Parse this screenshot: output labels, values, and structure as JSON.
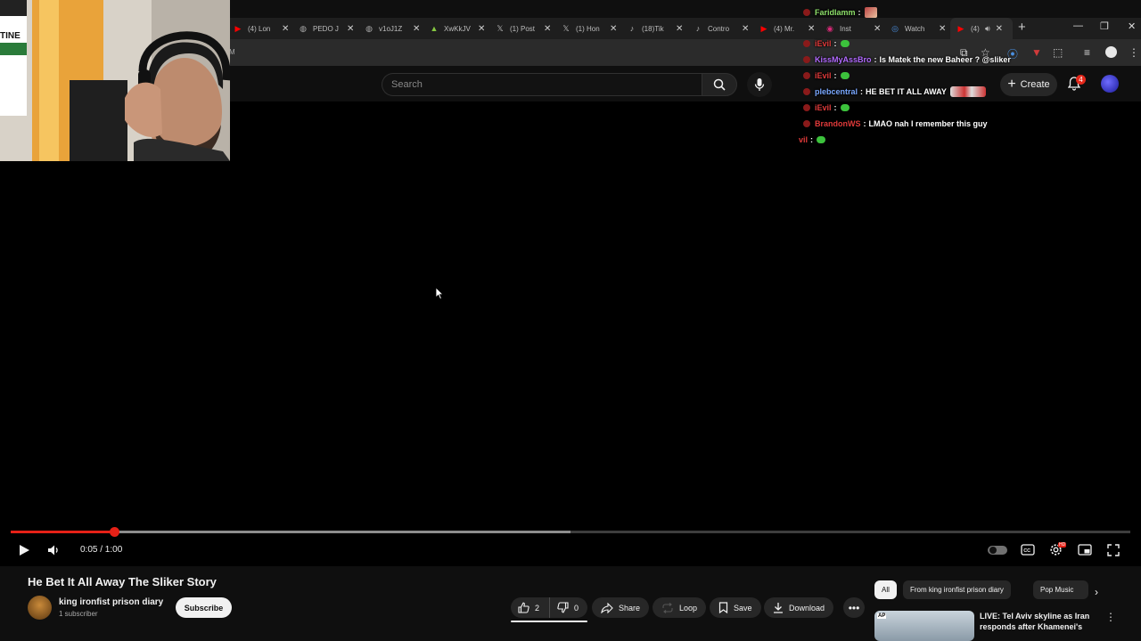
{
  "browser": {
    "tabs": [
      {
        "title": "(4) Lon",
        "icon": "youtube-icon",
        "color": "#ff0000"
      },
      {
        "title": "PEDO J",
        "icon": "globe-icon",
        "color": "#aaaaaa"
      },
      {
        "title": "v1oJ1Z",
        "icon": "globe-icon",
        "color": "#aaaaaa"
      },
      {
        "title": "XwKkJV",
        "icon": "rumble-icon",
        "color": "#85c742"
      },
      {
        "title": "(1) Post",
        "icon": "x-icon",
        "color": "#ffffff"
      },
      {
        "title": "(1) Hon",
        "icon": "x-icon",
        "color": "#ffffff"
      },
      {
        "title": "(18)Tik",
        "icon": "tiktok-icon",
        "color": "#ffffff"
      },
      {
        "title": "Contro",
        "icon": "tiktok-icon",
        "color": "#ffffff"
      },
      {
        "title": "(4) Mr.",
        "icon": "youtube-icon",
        "color": "#ff0000"
      },
      {
        "title": "Inst",
        "icon": "instagram-icon",
        "color": "#d62976"
      },
      {
        "title": "Watch",
        "icon": "watch-icon",
        "color": "#4a90e2"
      },
      {
        "title": "(4)",
        "icon": "youtube-icon",
        "color": "#ff0000"
      }
    ],
    "address_fragment": "M"
  },
  "header": {
    "search_placeholder": "Search",
    "create_label": "Create",
    "notification_count": "4"
  },
  "player": {
    "time": "0:05 / 1:00",
    "progress_fraction": 0.0925,
    "buffered_fraction": 0.5
  },
  "video": {
    "title": "He Bet It All Away The Sliker Story",
    "channel": "king ironfist prison diary",
    "subscribers": "1 subscriber",
    "subscribe_label": "Subscribe",
    "likes": "2",
    "dislikes": "0",
    "share_label": "Share",
    "loop_label": "Loop",
    "save_label": "Save",
    "download_label": "Download"
  },
  "chips": [
    "All",
    "From king ironfist prison diary",
    "Pop Music"
  ],
  "recommendation": {
    "source_badge": "AP",
    "title": "LIVE: Tel Aviv skyline as Iran responds after Khamenei's"
  },
  "chat": [
    {
      "user": "Faridlamm",
      "color": "#8ee06a",
      "sep": ":",
      "msg": "",
      "emote": "image"
    },
    {
      "user": "iEvil",
      "color": "#e03a3a",
      "sep": ":",
      "msg": "",
      "emote": "green"
    },
    {
      "user": "KissMyAssBro",
      "color": "#b36bff",
      "sep": ":",
      "msg": "Is Matek the new Baheer ? @sliker",
      "emote": ""
    },
    {
      "user": "iEvil",
      "color": "#e03a3a",
      "sep": ":",
      "msg": "",
      "emote": "green"
    },
    {
      "user": "plebcentral",
      "color": "#7aa8ff",
      "sep": ":",
      "msg": "HE BET IT ALL AWAY",
      "emote": "car"
    },
    {
      "user": "iEvil",
      "color": "#e03a3a",
      "sep": ":",
      "msg": "",
      "emote": "green"
    },
    {
      "user": "BrandonWS",
      "color": "#e03a3a",
      "sep": ":",
      "msg": "LMAO nah I remember this guy",
      "emote": ""
    },
    {
      "user": "vil",
      "color": "#e03a3a",
      "sep": ":",
      "msg": "",
      "emote": "green"
    }
  ],
  "webcam": {
    "poster_text": "TINE"
  }
}
